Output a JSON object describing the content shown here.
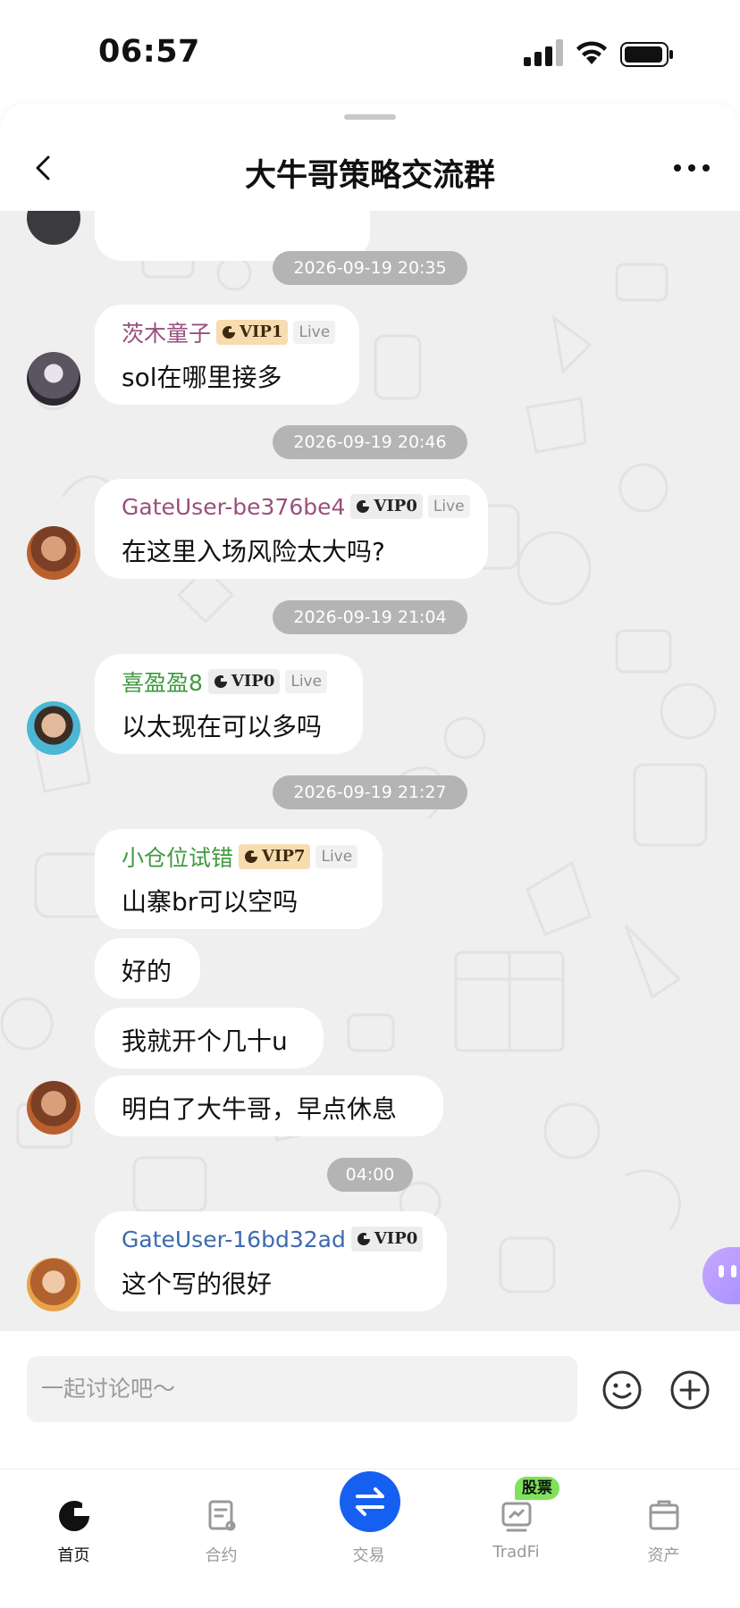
{
  "status_bar": {
    "time": "06:57"
  },
  "header": {
    "title": "大牛哥策略交流群"
  },
  "messages": [
    {
      "time": "2026-09-19 20:35",
      "user": "茨木童子",
      "user_color": "#9a4f7d",
      "vip": "VIP1",
      "vip_style": "gold",
      "live": "Live",
      "texts": [
        "sol在哪里接多"
      ]
    },
    {
      "time": "2026-09-19 20:46",
      "user": "GateUser-be376be4",
      "user_color": "#9a4f7d",
      "vip": "VIP0",
      "vip_style": "gray",
      "live": "Live",
      "texts": [
        "在这里入场风险太大吗?"
      ]
    },
    {
      "time": "2026-09-19 21:04",
      "user": "喜盈盈8",
      "user_color": "#3f9a3f",
      "vip": "VIP0",
      "vip_style": "gray",
      "live": "Live",
      "texts": [
        "以太现在可以多吗"
      ]
    },
    {
      "time": "2026-09-19 21:27",
      "user": "小仓位试错",
      "user_color": "#3f9a3f",
      "vip": "VIP7",
      "vip_style": "gold",
      "live": "Live",
      "texts": [
        "山寨br可以空吗",
        "好的",
        "我就开个几十u",
        "明白了大牛哥，早点休息"
      ]
    },
    {
      "time": "04:00",
      "user": "GateUser-16bd32ad",
      "user_color": "#3d6ab0",
      "vip": "VIP0",
      "vip_style": "gray",
      "live": "",
      "texts": [
        "这个写的很好"
      ]
    }
  ],
  "input": {
    "placeholder": "一起讨论吧～"
  },
  "tabs": [
    {
      "label": "首页",
      "active": true
    },
    {
      "label": "合约",
      "active": false
    },
    {
      "label": "交易",
      "active": false
    },
    {
      "label": "TradFi",
      "active": false,
      "badge": "股票"
    },
    {
      "label": "资产",
      "active": false
    }
  ],
  "colors": {
    "accent": "#1560f0",
    "chat_bg": "#efefef",
    "time_pill": "#b4b4b4",
    "badge": "#7fe25a"
  }
}
